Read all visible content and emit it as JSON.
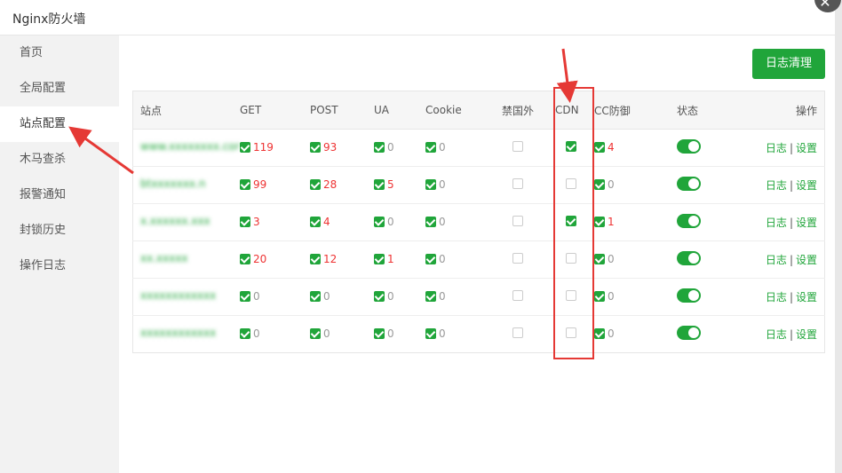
{
  "window": {
    "title": "Nginx防火墙",
    "close_symbol": "✕"
  },
  "sidebar": {
    "items": [
      {
        "label": "首页",
        "active": false
      },
      {
        "label": "全局配置",
        "active": false
      },
      {
        "label": "站点配置",
        "active": true
      },
      {
        "label": "木马查杀",
        "active": false
      },
      {
        "label": "报警通知",
        "active": false
      },
      {
        "label": "封锁历史",
        "active": false
      },
      {
        "label": "操作日志",
        "active": false
      }
    ]
  },
  "main": {
    "clear_button": "日志清理",
    "table": {
      "headers": {
        "site": "站点",
        "get": "GET",
        "post": "POST",
        "ua": "UA",
        "cookie": "Cookie",
        "geo": "禁国外",
        "cdn": "CDN",
        "cc": "CC防御",
        "status": "状态",
        "ops": "操作"
      },
      "rows": [
        {
          "site": "www.xxxxxxxx.com",
          "get": "119",
          "post": "93",
          "ua": "0",
          "cookie": "0",
          "geo": false,
          "cdn": true,
          "cc": "4",
          "status": true,
          "op_log": "日志",
          "op_sep": "|",
          "op_settings": "设置"
        },
        {
          "site": "btxxxxxxx.n",
          "get": "99",
          "post": "28",
          "ua": "5",
          "cookie": "0",
          "geo": false,
          "cdn": false,
          "cc": "0",
          "status": true,
          "op_log": "日志",
          "op_sep": "|",
          "op_settings": "设置"
        },
        {
          "site": "x.xxxxxx.xxx",
          "get": "3",
          "post": "4",
          "ua": "0",
          "cookie": "0",
          "geo": false,
          "cdn": true,
          "cc": "1",
          "status": true,
          "op_log": "日志",
          "op_sep": "|",
          "op_settings": "设置"
        },
        {
          "site": "xx.xxxxx",
          "get": "20",
          "post": "12",
          "ua": "1",
          "cookie": "0",
          "geo": false,
          "cdn": false,
          "cc": "0",
          "status": true,
          "op_log": "日志",
          "op_sep": "|",
          "op_settings": "设置"
        },
        {
          "site": "xxxxxxxxxxxx",
          "get": "0",
          "post": "0",
          "ua": "0",
          "cookie": "0",
          "geo": false,
          "cdn": false,
          "cc": "0",
          "status": true,
          "op_log": "日志",
          "op_sep": "|",
          "op_settings": "设置"
        },
        {
          "site": "xxxxxxxxxxxx",
          "get": "0",
          "post": "0",
          "ua": "0",
          "cookie": "0",
          "geo": false,
          "cdn": false,
          "cc": "0",
          "status": true,
          "op_log": "日志",
          "op_sep": "|",
          "op_settings": "设置"
        }
      ]
    }
  },
  "colors": {
    "accent": "#20a53a",
    "highlight": "#e53935",
    "count": "#e33333"
  }
}
